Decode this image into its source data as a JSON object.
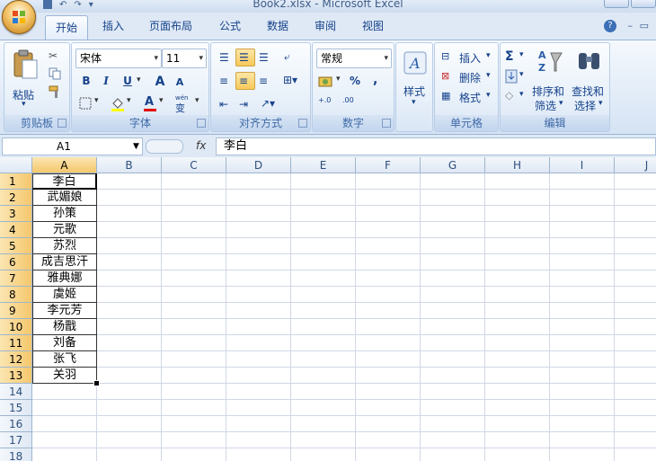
{
  "window": {
    "title": "Book2.xlsx - Microsoft Excel"
  },
  "tabs": [
    "开始",
    "插入",
    "页面布局",
    "公式",
    "数据",
    "审阅",
    "视图"
  ],
  "ribbon": {
    "clipboard": {
      "label": "剪贴板",
      "paste": "粘贴"
    },
    "font": {
      "label": "字体",
      "name": "宋体",
      "size": "11",
      "bold": "B",
      "italic": "I",
      "underline": "U",
      "grow": "A",
      "shrink": "A",
      "color": "A",
      "phonetic": "wén"
    },
    "alignment": {
      "label": "对齐方式"
    },
    "number": {
      "label": "数字",
      "format": "常规",
      "percent": "%",
      "comma": ",",
      "inc": "+.0",
      "dec": ".00"
    },
    "styles": {
      "label": "样式"
    },
    "cells": {
      "label": "单元格",
      "insert": "插入",
      "delete": "删除",
      "format": "格式"
    },
    "editing": {
      "label": "编辑",
      "sigma": "Σ",
      "sort": "排序和",
      "sort2": "筛选",
      "find": "查找和",
      "find2": "选择"
    }
  },
  "formula_bar": {
    "name_box": "A1",
    "fx": "fx",
    "value": "李白"
  },
  "columns": [
    "A",
    "B",
    "C",
    "D",
    "E",
    "F",
    "G",
    "H",
    "I",
    "J"
  ],
  "rows": [
    "1",
    "2",
    "3",
    "4",
    "5",
    "6",
    "7",
    "8",
    "9",
    "10",
    "11",
    "12",
    "13",
    "14",
    "15",
    "16",
    "17",
    "18"
  ],
  "cells_A": [
    "李白",
    "武媚娘",
    "孙策",
    "元歌",
    "苏烈",
    "成吉思汗",
    "雅典娜",
    "虞姬",
    "李元芳",
    "杨戬",
    "刘备",
    "张飞",
    "关羽"
  ],
  "colors": {
    "accent": "#15428b",
    "selection": "#f5c76c"
  }
}
